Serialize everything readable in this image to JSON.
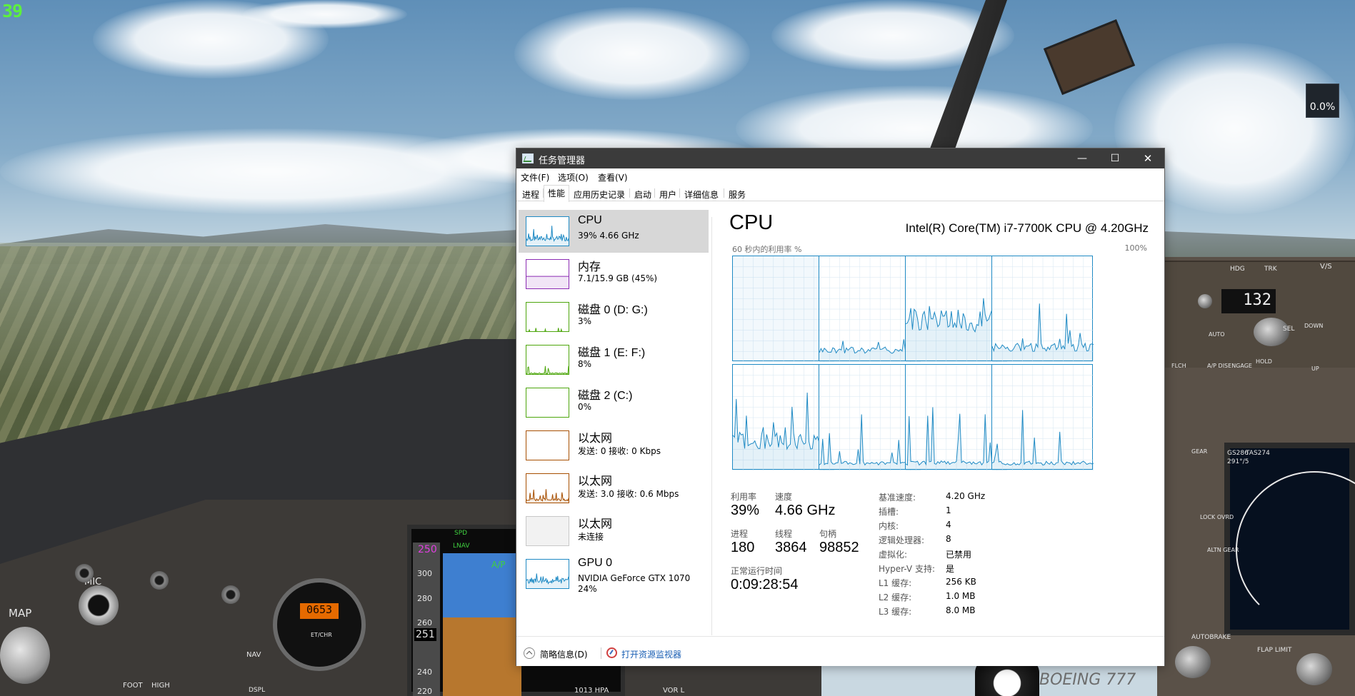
{
  "overlay": {
    "fps_counter": "39",
    "meter_widget": "0.0%"
  },
  "scene": {
    "mcp_heading_display": "132",
    "mcp_hdg_label": "HDG",
    "mcp_trk_label": "TRK",
    "mcp_vs_label": "V/S",
    "mcp_sel_label": "SEL",
    "mcp_hold_label": "HOLD",
    "mcp_ap_disengage": "A/P DISENGAGE",
    "mcp_down_label": "DOWN",
    "mcp_up_label": "UP",
    "mcp_flch_label": "FLCH",
    "mcp_auto_label": "AUTO",
    "map_label": "MAP",
    "mic_label": "MIC",
    "clock_display": "0653",
    "clock_et_label": "ET/CHR",
    "pfd_speed": "250",
    "pfd_speed_top": "251",
    "pfd_spd_label": "SPD",
    "pfd_lnav_label": "LNAV",
    "pfd_ap_label": "A/P",
    "pfd_ticks": [
      "300",
      "280",
      "260",
      "240",
      "220"
    ],
    "pfd_baro": "1013 HPA",
    "nav_label": "NAV",
    "dspl_label": "DSPL",
    "foot_label": "FOOT",
    "high_label": "HIGH",
    "autobrake_label": "AUTOBRAKE",
    "flap_limit_label": "FLAP LIMIT",
    "gear_label": "GEAR",
    "nd_gs": "GS286",
    "nd_tas": "TAS274",
    "nd_track": "291°/5",
    "vor_label": "VOR L",
    "alt_gear": "ALTN GEAR",
    "lock_ovrd": "LOCK OVRD",
    "brand": "BOEING 777"
  },
  "taskmgr": {
    "title": "任务管理器",
    "window_buttons": {
      "minimize": "—",
      "maximize": "☐",
      "close": "✕"
    },
    "menu": [
      "文件(F)",
      "选项(O)",
      "查看(V)"
    ],
    "tabs": [
      "进程",
      "性能",
      "应用历史记录",
      "启动",
      "用户",
      "详细信息",
      "服务"
    ],
    "active_tab": "性能",
    "devices": [
      {
        "name": "CPU",
        "sub": "39% 4.66 GHz",
        "color": "#1f8ac4",
        "selected": true
      },
      {
        "name": "内存",
        "sub": "7.1/15.9 GB (45%)",
        "color": "#8b2bb3"
      },
      {
        "name": "磁盘 0 (D: G:)",
        "sub": "3%",
        "color": "#4da60c"
      },
      {
        "name": "磁盘 1 (E: F:)",
        "sub": "8%",
        "color": "#4da60c"
      },
      {
        "name": "磁盘 2 (C:)",
        "sub": "0%",
        "color": "#4da60c"
      },
      {
        "name": "以太网",
        "sub": "发送: 0 接收: 0 Kbps",
        "color": "#a74f01"
      },
      {
        "name": "以太网",
        "sub": "发送: 3.0 接收: 0.6 Mbps",
        "color": "#a74f01"
      },
      {
        "name": "以太网",
        "sub": "未连接",
        "color": "#a0a0a0"
      },
      {
        "name": "GPU 0",
        "sub": "NVIDIA GeForce GTX 1070",
        "sub2": "24%",
        "color": "#1f8ac4"
      }
    ],
    "panel": {
      "title": "CPU",
      "model": "Intel(R) Core(TM) i7-7700K CPU @ 4.20GHz",
      "graph_caption": "60 秒内的利用率 %",
      "graph_max": "100%",
      "cores": 8
    },
    "stats": {
      "util_label": "利用率",
      "util_value": "39%",
      "speed_label": "速度",
      "speed_value": "4.66 GHz",
      "proc_label": "进程",
      "proc_value": "180",
      "thread_label": "线程",
      "thread_value": "3864",
      "handle_label": "句柄",
      "handle_value": "98852",
      "uptime_label": "正常运行时间",
      "uptime_value": "0:09:28:54"
    },
    "specs": [
      {
        "key": "基准速度:",
        "value": "4.20 GHz"
      },
      {
        "key": "插槽:",
        "value": "1"
      },
      {
        "key": "内核:",
        "value": "4"
      },
      {
        "key": "逻辑处理器:",
        "value": "8"
      },
      {
        "key": "虚拟化:",
        "value": "已禁用"
      },
      {
        "key": "Hyper-V 支持:",
        "value": "是"
      },
      {
        "key": "L1 缓存:",
        "value": "256 KB"
      },
      {
        "key": "L2 缓存:",
        "value": "1.0 MB"
      },
      {
        "key": "L3 缓存:",
        "value": "8.0 MB"
      }
    ],
    "footer": {
      "less_details": "简略信息(D)",
      "open_resmon": "打开资源监视器"
    }
  }
}
